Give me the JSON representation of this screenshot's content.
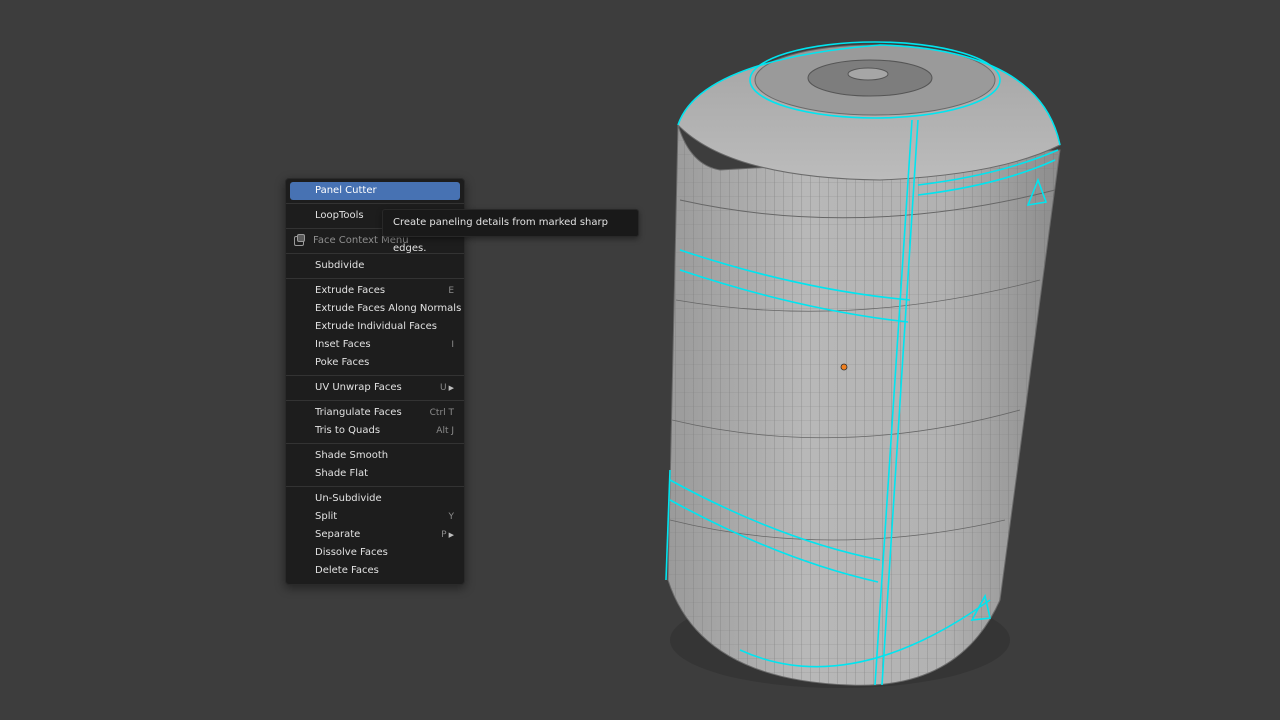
{
  "viewport": {
    "object_name": "can-mesh",
    "background_color": "#3d3d3d",
    "mesh_color": "#bdbdbd",
    "sharp_edge_color": "#00e5f0",
    "origin_color": "#f08020"
  },
  "context_menu": {
    "items": [
      {
        "label": "Panel Cutter",
        "shortcut": "",
        "active": true
      },
      {
        "label": "LoopTools",
        "shortcut": "",
        "submenu": false
      },
      {
        "label": "Face Context Menu",
        "type": "header"
      },
      {
        "label": "Subdivide",
        "shortcut": ""
      },
      {
        "label": "Extrude Faces",
        "shortcut": "E"
      },
      {
        "label": "Extrude Faces Along Normals",
        "shortcut": ""
      },
      {
        "label": "Extrude Individual Faces",
        "shortcut": ""
      },
      {
        "label": "Inset Faces",
        "shortcut": "I"
      },
      {
        "label": "Poke Faces",
        "shortcut": ""
      },
      {
        "label": "UV Unwrap Faces",
        "shortcut": "U"
      },
      {
        "label": "Triangulate Faces",
        "shortcut": "Ctrl T"
      },
      {
        "label": "Tris to Quads",
        "shortcut": "Alt J"
      },
      {
        "label": "Shade Smooth",
        "shortcut": ""
      },
      {
        "label": "Shade Flat",
        "shortcut": ""
      },
      {
        "label": "Un-Subdivide",
        "shortcut": ""
      },
      {
        "label": "Split",
        "shortcut": "Y"
      },
      {
        "label": "Separate",
        "shortcut": "P"
      },
      {
        "label": "Dissolve Faces",
        "shortcut": ""
      },
      {
        "label": "Delete Faces",
        "shortcut": ""
      }
    ]
  },
  "tooltip": {
    "text": "Create paneling details from marked sharp edges."
  }
}
